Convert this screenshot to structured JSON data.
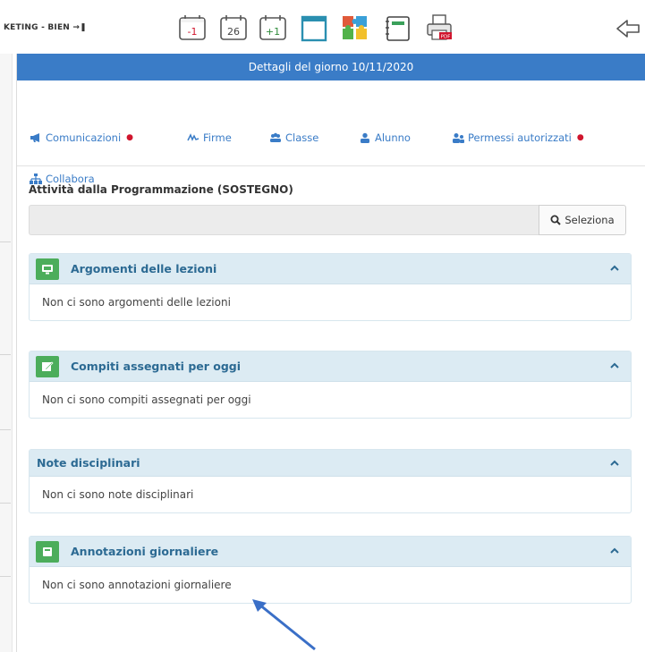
{
  "toolbar": {
    "class_label": "KETING - BIEN",
    "icons": [
      "calendar-minus-one-icon",
      "calendar-today-icon",
      "calendar-plus-one-icon",
      "blank-page-icon",
      "puzzle-icon",
      "notes-icon",
      "pdf-print-icon",
      "back-arrow-icon"
    ],
    "calendar_labels": [
      "-1",
      "26",
      "+1"
    ]
  },
  "panel": {
    "header": "Dettagli del giorno 10/11/2020",
    "tabs": [
      {
        "label": "Comunicazioni",
        "icon": "megaphone-icon",
        "marked": true
      },
      {
        "label": "Firme",
        "icon": "signature-icon",
        "marked": false
      },
      {
        "label": "Classe",
        "icon": "group-icon",
        "marked": false
      },
      {
        "label": "Alunno",
        "icon": "user-icon",
        "marked": false
      },
      {
        "label": "Permessi autorizzati",
        "icon": "users-icon",
        "marked": true
      },
      {
        "label": "Collabora",
        "icon": "sitemap-icon",
        "marked": false
      }
    ],
    "section_title": "Attività dalla Programmazione (SOSTEGNO)",
    "select_value": "",
    "select_button": "Seleziona"
  },
  "cards": [
    {
      "title": "Argomenti delle lezioni",
      "body": "Non ci sono argomenti delle lezioni",
      "icon": "monitor-icon"
    },
    {
      "title": "Compiti assegnati per oggi",
      "body": "Non ci sono compiti assegnati per oggi",
      "icon": "edit-icon"
    },
    {
      "title": "Note disciplinari",
      "body": "Non ci sono note disciplinari",
      "icon": ""
    },
    {
      "title": "Annotazioni giornaliere",
      "body": "Non ci sono annotazioni giornaliere",
      "icon": "note-icon"
    }
  ],
  "colors": {
    "header_blue": "#3a7cc7",
    "card_header_bg": "#dcebf3",
    "card_title": "#2c6a93",
    "badge_green": "#4cad5b",
    "alert_red": "#d0152d",
    "pointer_arrow": "#3a6fc7"
  }
}
